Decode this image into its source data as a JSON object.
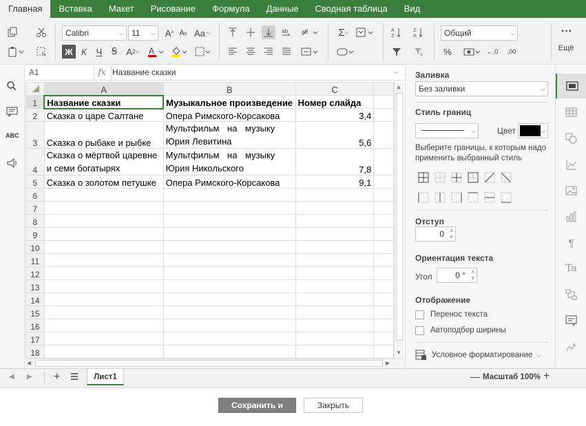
{
  "tabs": [
    "Главная",
    "Вставка",
    "Макет",
    "Рисование",
    "Формула",
    "Данные",
    "Сводная таблица",
    "Вид"
  ],
  "toolbar": {
    "font_name": "Calibri",
    "font_size": "11",
    "bold": "Ж",
    "italic": "К",
    "underline": "Ч",
    "strike": "Ꞩ",
    "number_format": "Общий",
    "more_label": "Ещё",
    "case_label": "Aa",
    "percent": "%"
  },
  "formula_bar": {
    "cell_ref": "A1",
    "fx": "fx",
    "content": "Название сказки"
  },
  "sheet": {
    "columns": [
      "A",
      "B",
      "C"
    ],
    "rows": [
      {
        "n": "1",
        "a": "Название сказки",
        "b": "Музыкальное произведение",
        "c": "Номер слайда"
      },
      {
        "n": "2",
        "a": "Сказка о царе Салтане",
        "b": "Опера Римского-Корсакова",
        "c": "3,4"
      },
      {
        "n": "3",
        "a": "Сказка о рыбаке и рыбке",
        "b1": "Мультфильм на музыку",
        "b2": "Юрия Левитина",
        "c": "5,6"
      },
      {
        "n": "4",
        "a1": "Сказка о мёртвой царевне",
        "a2": "и семи богатырях",
        "b1": "Мультфильм на музыку",
        "b2": "Юрия Никольского",
        "c": "7,8"
      },
      {
        "n": "5",
        "a": "Сказка о золотом петушке",
        "b": "Опера Римского-Корсакова",
        "c": "9,1"
      }
    ],
    "empty_rows": [
      "6",
      "7",
      "8",
      "9",
      "10",
      "11",
      "12",
      "13",
      "14",
      "15",
      "16",
      "17",
      "18"
    ]
  },
  "panel": {
    "fill_title": "Заливка",
    "fill_value": "Без заливки",
    "border_style_title": "Стиль границ",
    "color_label": "Цвет",
    "border_hint": "Выберите границы, к которым надо применить выбранный стиль",
    "indent_title": "Отступ",
    "indent_value": "0",
    "orientation_title": "Ориентация текста",
    "angle_label": "Угол",
    "angle_value": "0 °",
    "display_title": "Отображение",
    "wrap_label": "Перенос текста",
    "autofit_label": "Автоподбор ширины",
    "cond_format_label": "Условное форматирование"
  },
  "sheet_tab": "Лист1",
  "zoom_label": "Масштаб 100%",
  "footer": {
    "save_label": "Сохранить и выйти",
    "close_label": "Закрыть"
  },
  "colors": {
    "tab_bar": "#3a7f3e",
    "border_color": "#000000",
    "save_button": "#808080"
  }
}
